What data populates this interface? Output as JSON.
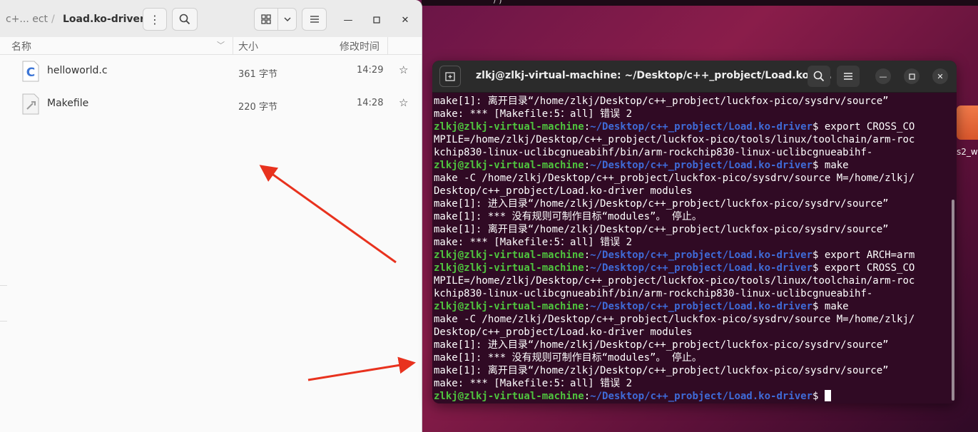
{
  "desktop": {
    "right_text": "s2_w",
    "top_text": "/ )"
  },
  "file_manager": {
    "breadcrumb_prev": "c+... ect",
    "breadcrumb_current": "Load.ko-driver",
    "columns": {
      "name": "名称",
      "size": "大小",
      "modified": "修改时间"
    },
    "files": [
      {
        "name": "helloworld.c",
        "size": "361 字节",
        "time": "14:29",
        "icon": "c-source-file-icon"
      },
      {
        "name": "Makefile",
        "size": "220 字节",
        "time": "14:28",
        "icon": "makefile-icon"
      }
    ]
  },
  "terminal": {
    "title": "zlkj@zlkj-virtual-machine: ~/Desktop/c++_probject/Load.ko-d...",
    "prompt_user": "zlkj@zlkj-virtual-machine",
    "prompt_path": "~/Desktop/c++_probject/Load.ko-driver",
    "lines": [
      {
        "type": "out",
        "text": "make[1]: 离开目录“/home/zlkj/Desktop/c++_probject/luckfox-pico/sysdrv/source”"
      },
      {
        "type": "out",
        "text": "make: *** [Makefile:5：all] 错误 2"
      },
      {
        "type": "cmd",
        "cmd": " export CROSS_CO"
      },
      {
        "type": "out",
        "text": "MPILE=/home/zlkj/Desktop/c++_probject/luckfox-pico/tools/linux/toolchain/arm-roc"
      },
      {
        "type": "out",
        "text": "kchip830-linux-uclibcgnueabihf/bin/arm-rockchip830-linux-uclibcgnueabihf-"
      },
      {
        "type": "cmd",
        "cmd": " make"
      },
      {
        "type": "out",
        "text": "make -C /home/zlkj/Desktop/c++_probject/luckfox-pico/sysdrv/source M=/home/zlkj/"
      },
      {
        "type": "out",
        "text": "Desktop/c++_probject/Load.ko-driver modules"
      },
      {
        "type": "out",
        "text": "make[1]: 进入目录“/home/zlkj/Desktop/c++_probject/luckfox-pico/sysdrv/source”"
      },
      {
        "type": "out",
        "text": "make[1]: *** 没有规则可制作目标“modules”。 停止。"
      },
      {
        "type": "out",
        "text": "make[1]: 离开目录“/home/zlkj/Desktop/c++_probject/luckfox-pico/sysdrv/source”"
      },
      {
        "type": "out",
        "text": "make: *** [Makefile:5：all] 错误 2"
      },
      {
        "type": "cmd",
        "cmd": " export ARCH=arm"
      },
      {
        "type": "cmd",
        "cmd": " export CROSS_CO"
      },
      {
        "type": "out",
        "text": "MPILE=/home/zlkj/Desktop/c++_probject/luckfox-pico/tools/linux/toolchain/arm-roc"
      },
      {
        "type": "out",
        "text": "kchip830-linux-uclibcgnueabihf/bin/arm-rockchip830-linux-uclibcgnueabihf-"
      },
      {
        "type": "cmd",
        "cmd": " make"
      },
      {
        "type": "out",
        "text": "make -C /home/zlkj/Desktop/c++_probject/luckfox-pico/sysdrv/source M=/home/zlkj/"
      },
      {
        "type": "out",
        "text": "Desktop/c++_probject/Load.ko-driver modules"
      },
      {
        "type": "out",
        "text": "make[1]: 进入目录“/home/zlkj/Desktop/c++_probject/luckfox-pico/sysdrv/source”"
      },
      {
        "type": "out",
        "text": "make[1]: *** 没有规则可制作目标“modules”。 停止。"
      },
      {
        "type": "out",
        "text": "make[1]: 离开目录“/home/zlkj/Desktop/c++_probject/luckfox-pico/sysdrv/source”"
      },
      {
        "type": "out",
        "text": "make: *** [Makefile:5：all] 错误 2"
      },
      {
        "type": "prompt",
        "cmd": " "
      }
    ]
  },
  "colors": {
    "terminal_bg": "#300a24",
    "prompt_user": "#4fc43e",
    "prompt_path": "#3f6bd8",
    "annotation_arrow": "#e8321e"
  }
}
